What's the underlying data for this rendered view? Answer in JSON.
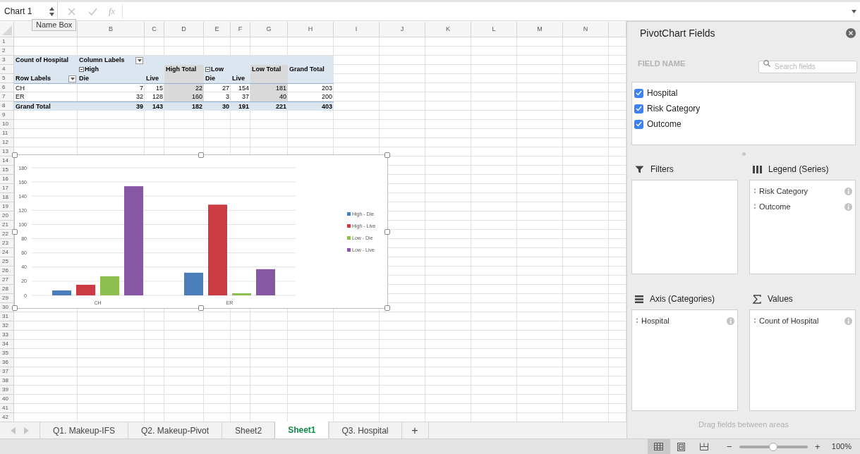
{
  "formula_bar": {
    "name_box": "Chart 1",
    "function_label": "fx",
    "tooltip": "Name Box"
  },
  "sheet": {
    "columns": [
      "B",
      "C",
      "D",
      "E",
      "F",
      "G",
      "H",
      "I",
      "J",
      "K",
      "L",
      "M",
      "N"
    ],
    "row_numbers": [
      "1",
      "2",
      "3",
      "4",
      "5",
      "6",
      "7",
      "8",
      "9",
      "10",
      "11",
      "12",
      "13",
      "14",
      "15",
      "16",
      "17",
      "18",
      "19",
      "20",
      "21",
      "22",
      "23",
      "24",
      "25",
      "26",
      "27",
      "28",
      "29",
      "30",
      "31",
      "32",
      "33",
      "34",
      "35",
      "36",
      "37",
      "38",
      "39",
      "40",
      "41",
      "42"
    ]
  },
  "pivot_table": {
    "rows": [
      {
        "kind": "header",
        "cells": [
          {
            "text": "Count of Hospital"
          },
          {
            "text": "Column Labels",
            "filter": true
          },
          null,
          null,
          null,
          null,
          null,
          null
        ]
      },
      {
        "kind": "header",
        "cells": [
          null,
          {
            "text": "High",
            "collapse": true
          },
          null,
          {
            "text": "High Total",
            "subtotal": true
          },
          {
            "text": "Low",
            "collapse": true
          },
          null,
          {
            "text": "Low Total",
            "subtotal": true
          },
          {
            "text": "Grand Total"
          }
        ]
      },
      {
        "kind": "header",
        "cells": [
          {
            "text": "Row Labels",
            "filter": true
          },
          {
            "text": "Die"
          },
          {
            "text": "Live"
          },
          {
            "subtotal": true
          },
          {
            "text": "Die"
          },
          {
            "text": "Live"
          },
          {
            "subtotal": true
          },
          null
        ]
      },
      {
        "kind": "data",
        "cells": [
          {
            "text": "CH"
          },
          {
            "text": "7"
          },
          {
            "text": "15"
          },
          {
            "text": "22",
            "subtotal": true
          },
          {
            "text": "27"
          },
          {
            "text": "154"
          },
          {
            "text": "181",
            "subtotal": true
          },
          {
            "text": "203"
          }
        ]
      },
      {
        "kind": "data",
        "cells": [
          {
            "text": "ER"
          },
          {
            "text": "32"
          },
          {
            "text": "128"
          },
          {
            "text": "160",
            "subtotal": true
          },
          {
            "text": "3"
          },
          {
            "text": "37"
          },
          {
            "text": "40",
            "subtotal": true
          },
          {
            "text": "200"
          }
        ]
      },
      {
        "kind": "total",
        "cells": [
          {
            "text": "Grand Total"
          },
          {
            "text": "39"
          },
          {
            "text": "143"
          },
          {
            "text": "182"
          },
          {
            "text": "30"
          },
          {
            "text": "191"
          },
          {
            "text": "221"
          },
          {
            "text": "403"
          }
        ]
      }
    ]
  },
  "chart": {
    "chart_data": {
      "type": "bar",
      "grid": true,
      "legend": true,
      "categories": [
        "CH",
        "ER"
      ],
      "ylim": [
        0,
        180
      ],
      "yticks": [
        {
          "value": 0,
          "label": "0"
        },
        {
          "value": 20,
          "label": "20"
        },
        {
          "value": 40,
          "label": "40"
        },
        {
          "value": 60,
          "label": "60"
        },
        {
          "value": 80,
          "label": "80"
        },
        {
          "value": 100,
          "label": "100"
        },
        {
          "value": 120,
          "label": "120"
        },
        {
          "value": 140,
          "label": "140"
        },
        {
          "value": 160,
          "label": "160"
        },
        {
          "value": 180,
          "label": "180"
        }
      ],
      "series": [
        {
          "name": "High - Die",
          "color": "#4a7ebb",
          "values": [
            7,
            32
          ]
        },
        {
          "name": "High - Live",
          "color": "#cc3a44",
          "values": [
            15,
            128
          ]
        },
        {
          "name": "Low - Die",
          "color": "#8cbf4f",
          "values": [
            27,
            3
          ]
        },
        {
          "name": "Low - Live",
          "color": "#8657a2",
          "values": [
            154,
            37
          ]
        }
      ]
    }
  },
  "sheet_tabs": [
    {
      "label": "Q1. Makeup-IFS",
      "selected": false
    },
    {
      "label": "Q2. Makeup-Pivot",
      "selected": false
    },
    {
      "label": "Sheet2",
      "selected": false
    },
    {
      "label": "Sheet1",
      "selected": true
    },
    {
      "label": "Q3. Hospital",
      "selected": false
    }
  ],
  "add_sheet": "+",
  "pivot_panel": {
    "title": "PivotChart Fields",
    "field_header": "FIELD NAME",
    "search_placeholder": "Search fields",
    "fields": [
      {
        "label": "Hospital",
        "checked": true
      },
      {
        "label": "Risk Category",
        "checked": true
      },
      {
        "label": "Outcome",
        "checked": true
      }
    ],
    "areas": [
      {
        "kind": "filters",
        "title": "Filters"
      },
      {
        "kind": "legend",
        "title": "Legend (Series)",
        "items": [
          "Risk Category",
          "Outcome"
        ]
      },
      {
        "kind": "axis",
        "title": "Axis (Categories)",
        "items": [
          "Hospital"
        ]
      },
      {
        "kind": "values",
        "title": "Values",
        "items": [
          "Count of Hospital"
        ]
      }
    ],
    "hint": "Drag fields between areas"
  },
  "status_bar": {
    "views": [
      {
        "kind": "normal",
        "selected": true
      },
      {
        "kind": "page_layout",
        "selected": false
      },
      {
        "kind": "page_break",
        "selected": false
      }
    ],
    "zoom": {
      "minus": "−",
      "plus": "+",
      "level": 0.5,
      "reading": "100%"
    }
  }
}
